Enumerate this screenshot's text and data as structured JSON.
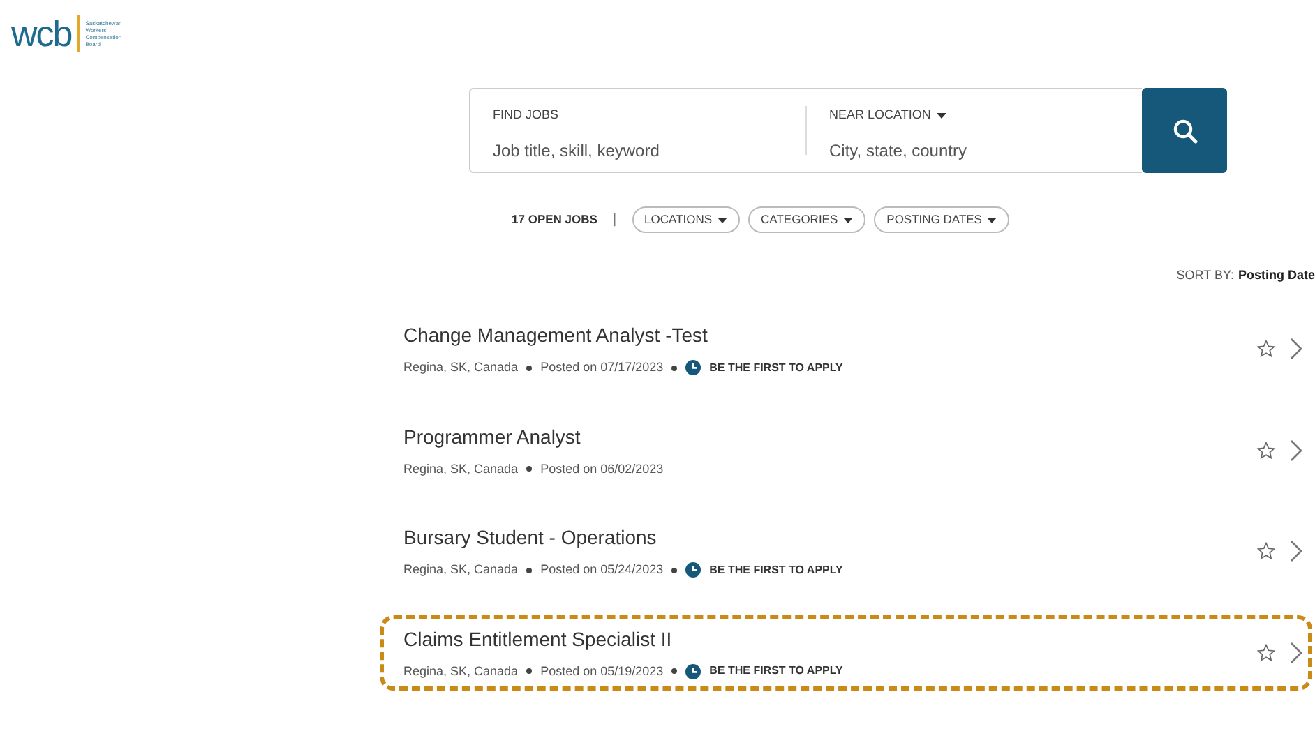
{
  "logo": {
    "mark": "wcb",
    "org_lines": [
      "Saskatchewan",
      "Workers'",
      "Compensation",
      "Board"
    ]
  },
  "search": {
    "fields": [
      {
        "label": "FIND JOBS",
        "placeholder": "Job title, skill, keyword",
        "dropdown": false
      },
      {
        "label": "NEAR LOCATION",
        "placeholder": "City, state, country",
        "dropdown": true
      }
    ]
  },
  "filters": {
    "count": "17 OPEN JOBS",
    "separator": "|",
    "buttons": [
      "LOCATIONS",
      "CATEGORIES",
      "POSTING DATES"
    ]
  },
  "sort": {
    "label": "SORT BY:",
    "value": "Posting Date"
  },
  "jobs": [
    {
      "title": "Change Management Analyst -Test",
      "location": "Regina, SK, Canada",
      "posted": "Posted on 07/17/2023",
      "badge": "BE THE FIRST TO APPLY",
      "highlighted": false
    },
    {
      "title": "Programmer Analyst",
      "location": "Regina, SK, Canada",
      "posted": "Posted on 06/02/2023",
      "highlighted": false
    },
    {
      "title": "Bursary Student - Operations",
      "location": "Regina, SK, Canada",
      "posted": "Posted on 05/24/2023",
      "badge": "BE THE FIRST TO APPLY",
      "highlighted": false
    },
    {
      "title": "Claims Entitlement Specialist II",
      "location": "Regina, SK, Canada",
      "posted": "Posted on 05/19/2023",
      "badge": "BE THE FIRST TO APPLY",
      "highlighted": true
    }
  ]
}
